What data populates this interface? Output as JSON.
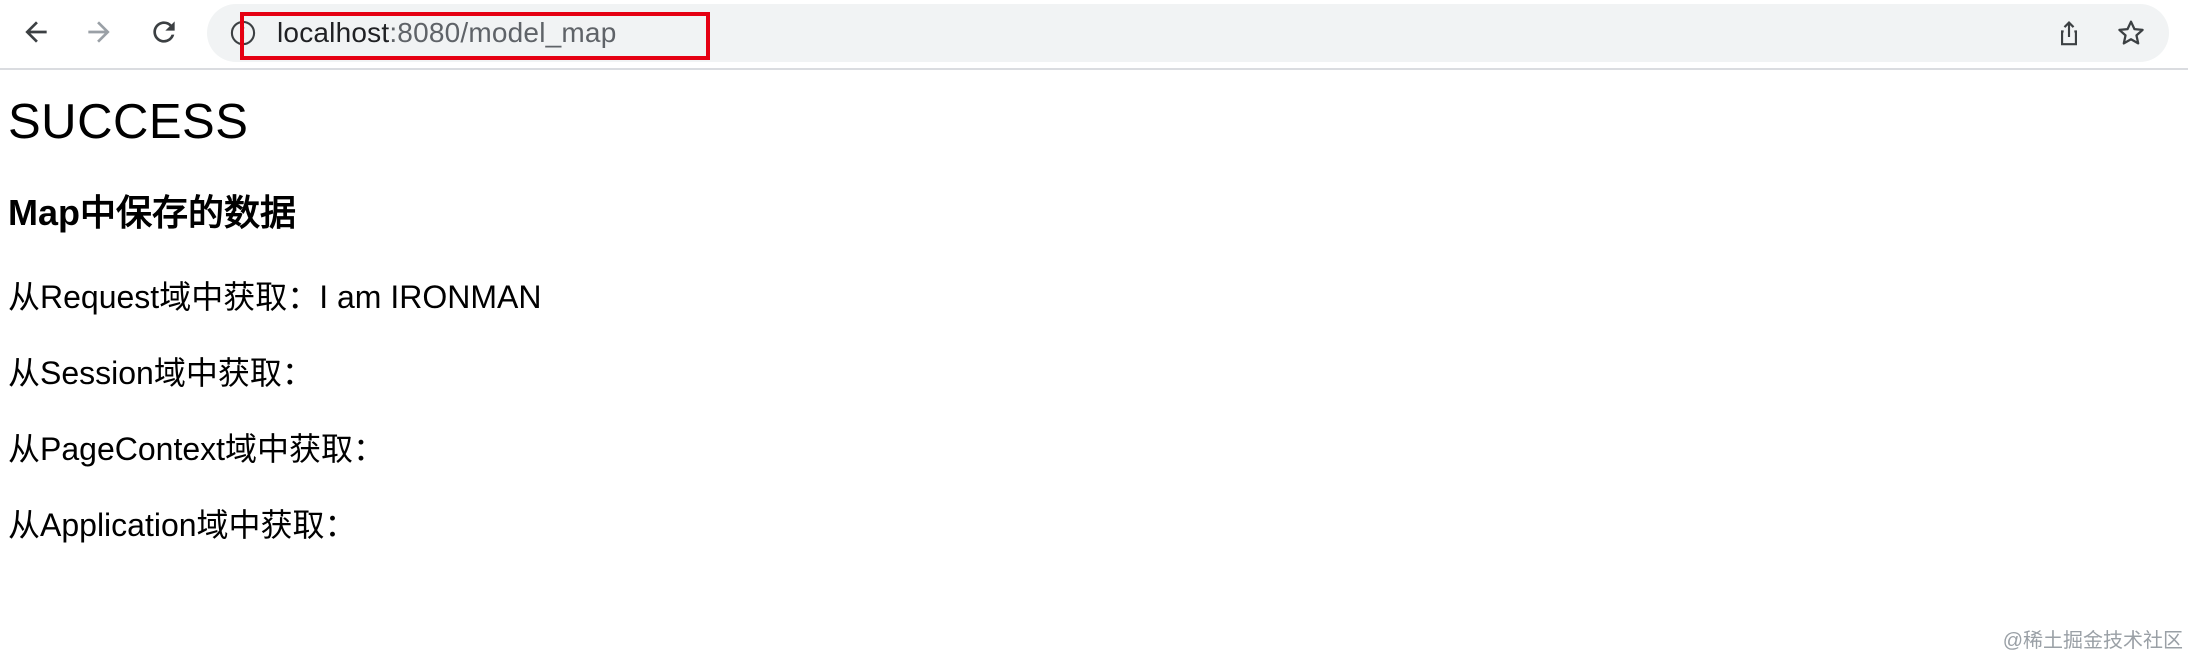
{
  "browser": {
    "url_host": "localhost",
    "url_rest": ":8080/model_map",
    "icons": {
      "back": "arrow-left-icon",
      "forward": "arrow-right-icon",
      "reload": "reload-icon",
      "site_info": "info-icon",
      "share": "share-icon",
      "bookmark": "star-icon"
    },
    "highlight_color": "#e50012"
  },
  "page": {
    "title": "SUCCESS",
    "subtitle": "Map中保存的数据",
    "lines": [
      "从Request域中获取：I am IRONMAN",
      "从Session域中获取：",
      "从PageContext域中获取：",
      "从Application域中获取："
    ]
  },
  "watermark": "@稀土掘金技术社区"
}
